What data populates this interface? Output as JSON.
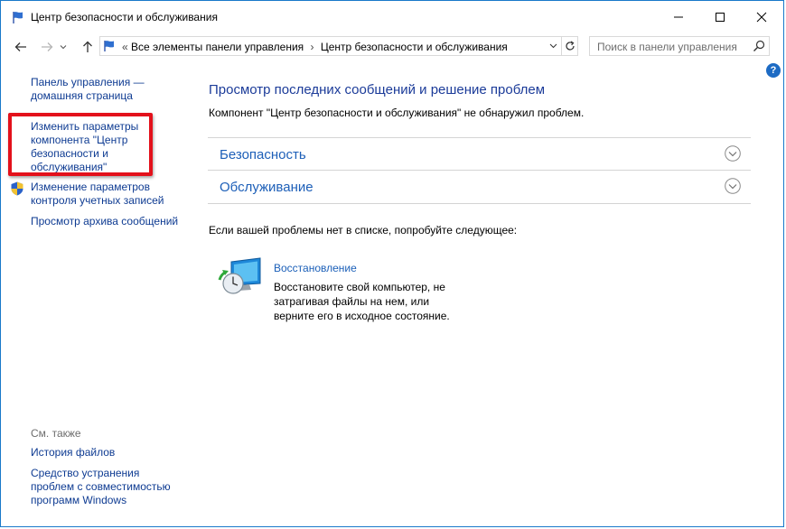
{
  "window": {
    "title": "Центр безопасности и обслуживания"
  },
  "nav": {
    "breadcrumb_prefix": "«",
    "breadcrumb_1": "Все элементы панели управления",
    "breadcrumb_sep": "›",
    "breadcrumb_2": "Центр безопасности и обслуживания",
    "search_placeholder": "Поиск в панели управления"
  },
  "sidebar": {
    "home_line1": "Панель управления —",
    "home_line2": "домашняя страница",
    "change_params": [
      "Изменить параметры",
      "компонента \"Центр",
      "безопасности и",
      "обслуживания\""
    ],
    "uac": [
      "Изменение параметров",
      "контроля учетных записей"
    ],
    "archive": "Просмотр архива сообщений",
    "see_also": "См. также",
    "file_history": "История файлов",
    "compat": [
      "Средство устранения",
      "проблем с совместимостью",
      "программ Windows"
    ]
  },
  "main": {
    "title": "Просмотр последних сообщений и решение проблем",
    "subtitle": "Компонент \"Центр безопасности и обслуживания\" не обнаружил проблем.",
    "sections": [
      "Безопасность",
      "Обслуживание"
    ],
    "try_text": "Если вашей проблемы нет в списке, попробуйте следующее:",
    "recovery_link": "Восстановление",
    "recovery_desc": [
      "Восстановите свой компьютер, не",
      "затрагивая файлы на нем, или",
      "верните его в исходное состояние."
    ]
  },
  "help_label": "?",
  "colors": {
    "link": "#0e3b92",
    "heading": "#1b3b99",
    "section": "#1d5fb8",
    "highlight": "#e3111b",
    "window_border": "#1979ca"
  },
  "icons": [
    "flag-icon",
    "minimize-icon",
    "maximize-icon",
    "close-icon",
    "back-arrow-icon",
    "forward-arrow-icon",
    "up-arrow-icon",
    "chevron-down-icon",
    "refresh-icon",
    "search-icon",
    "help-icon",
    "shield-icon",
    "recovery-icon"
  ]
}
